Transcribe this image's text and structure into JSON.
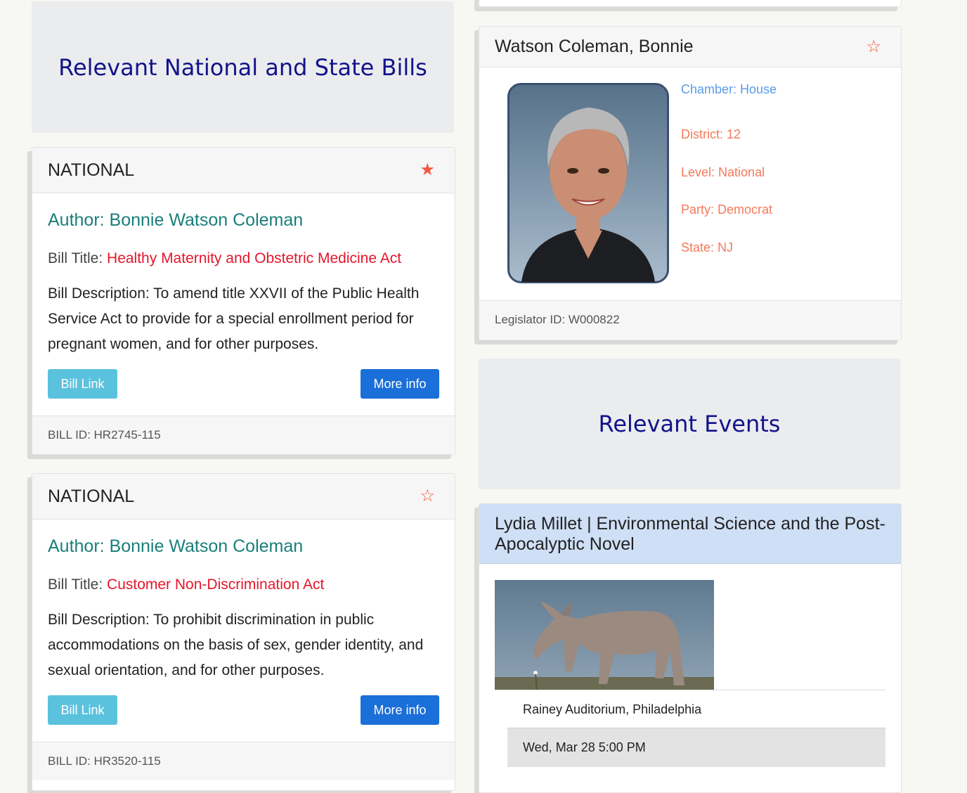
{
  "bills_heading": "Relevant National and State Bills",
  "events_heading": "Relevant Events",
  "bills": [
    {
      "level": "NATIONAL",
      "starred": true,
      "author_label": "Author: Bonnie Watson Coleman",
      "title_prefix": "Bill Title: ",
      "title": "Healthy Maternity and Obstetric Medicine Act",
      "description": "Bill Description: To amend title XXVII of the Public Health Service Act to provide for a special enrollment period for pregnant women, and for other purposes.",
      "link_label": "Bill Link",
      "more_label": "More info",
      "bill_id": "BILL ID: HR2745-115"
    },
    {
      "level": "NATIONAL",
      "starred": false,
      "author_label": "Author: Bonnie Watson Coleman",
      "title_prefix": "Bill Title: ",
      "title": "Customer Non-Discrimination Act",
      "description": "Bill Description: To prohibit discrimination in public accommodations on the basis of sex, gender identity, and sexual orientation, and for other purposes.",
      "link_label": "Bill Link",
      "more_label": "More info",
      "bill_id": "BILL ID: HR3520-115"
    }
  ],
  "legislator": {
    "name": "Watson Coleman, Bonnie",
    "starred": false,
    "chamber": "Chamber: House",
    "district": "District: 12",
    "level": "Level: National",
    "party": "Party: Democrat",
    "state": "State: NJ",
    "legislator_id": "Legislator ID: W000822"
  },
  "event": {
    "title": "Lydia Millet | Environmental Science and the Post-Apocalyptic Novel",
    "location": "Rainey Auditorium, Philadelphia",
    "datetime": "Wed, Mar 28 5:00 PM"
  },
  "icons": {
    "star_filled": "★",
    "star_outline": "☆"
  },
  "colors": {
    "heading_blue": "#12138a",
    "author_teal": "#1a7f7a",
    "bill_title_red": "#e5162b",
    "chamber_blue": "#5b9be8",
    "meta_orange": "#f4795a",
    "btn_info": "#5bc2dd",
    "btn_primary": "#1a6fd8",
    "event_header_bg": "#cfdff5"
  }
}
